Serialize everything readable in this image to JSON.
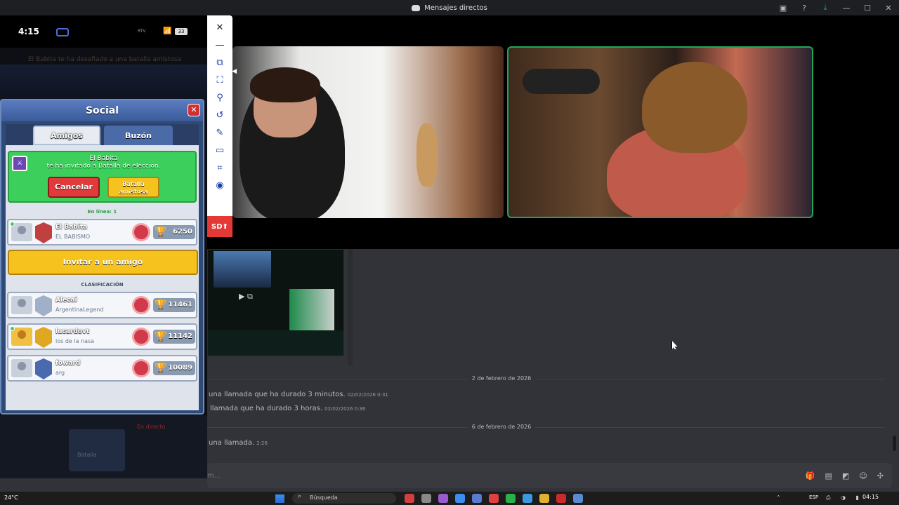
{
  "window": {
    "title": "Mensajes directos"
  },
  "titlebar_icons": [
    "screen-share-icon",
    "help-icon",
    "download-icon",
    "minimize-icon",
    "maximize-icon",
    "close-icon"
  ],
  "titlebar_glyphs": {
    "screen": "▣",
    "help": "?",
    "download": "⤓",
    "minimize": "—",
    "maximize": "☐",
    "close": "✕"
  },
  "snip_toolbar": {
    "icons": [
      "close-icon",
      "minimize-icon",
      "region-icon",
      "fullscreen-icon",
      "pin-icon",
      "undo-icon",
      "pen-icon",
      "rectangle-icon",
      "crop-icon",
      "record-icon"
    ],
    "glyphs": {
      "close": "✕",
      "minimize": "—",
      "region": "⧉",
      "fullscreen": "⛶",
      "pin": "⚲",
      "undo": "↺",
      "pen": "✎",
      "rectangle": "▭",
      "crop": "⌗",
      "record": "◉",
      "collapse": "◀"
    },
    "sd_label": "SD⬆"
  },
  "phone": {
    "status_time": "4:15",
    "status_rtv": "RTV",
    "wifi": "📶",
    "battery": "33",
    "bg_notice": "El Babita te ha desafiado a una batalla amistosa",
    "social": {
      "title": "Social",
      "close": "✕",
      "tabs": [
        {
          "label": "Amigos",
          "active": true
        },
        {
          "label": "Buzón",
          "active": false
        }
      ],
      "invite": {
        "badge": "⚔",
        "name": "El Babita",
        "description": "te ha invitado a Batalla de elección.",
        "cancel_label": "Cancelar",
        "friendly_label_1": "Batalla",
        "friendly_label_2": "amistosa"
      },
      "online_label": "En línea: 1",
      "online_friend": {
        "name": "El Babita",
        "clan": "EL BABISMO",
        "trophies": "6250"
      },
      "invite_button": "Invitar a un amigo",
      "ranking_label": "CLASIFICACIÓN",
      "trophy_glyph": "🏆",
      "ranking": [
        {
          "name": "Alecai",
          "clan": "ArgentinaLegend",
          "trophies": "11461"
        },
        {
          "name": "lucardovt",
          "clan": "los de la nasa",
          "trophies": "11142"
        },
        {
          "name": "foward",
          "clan": "arg",
          "trophies": "10089"
        }
      ]
    },
    "bottom": {
      "live_label": "En directo",
      "battle_label": "Batalla"
    }
  },
  "chat": {
    "play_label": "▶ ⧉",
    "date_1": "2 de febrero de 2026",
    "messages_1": [
      {
        "text": "una llamada que ha durado 3 minutos.",
        "time": "02/02/2026 0:31"
      },
      {
        "text": "llamada que ha durado 3 horas.",
        "time": "02/02/2026 0:36"
      }
    ],
    "date_2": "6 de febrero de 2026",
    "messages_2": [
      {
        "text": "una llamada.",
        "time": "2:26"
      }
    ],
    "input_placeholder": "m...",
    "input_icons": [
      "gift-icon",
      "gif-icon",
      "sticker-icon",
      "emoji-icon",
      "apps-icon"
    ],
    "input_glyphs": {
      "gift": "🎁",
      "gif": "▤",
      "sticker": "◩",
      "emoji": "☺",
      "apps": "✣"
    }
  },
  "taskbar": {
    "temperature": "24°C",
    "search_placeholder": "Búsqueda",
    "search_glyph": "⌕",
    "language": "ESP",
    "time": "04:15",
    "tray_caret": "⌃",
    "tray_icons": "⎙ ◑ ▮",
    "app_colors": [
      "#d04040",
      "#888888",
      "#9a5ad0",
      "#3a8ef0",
      "#5a7ad0",
      "#e04040",
      "#2ab04a",
      "#3a9ae0",
      "#e0b030",
      "#cc2a2a",
      "#5a8ad0"
    ]
  },
  "colors": {
    "discord_bg": "#313338",
    "speaking_ring": "#23a559",
    "snip_red": "#e53935"
  }
}
